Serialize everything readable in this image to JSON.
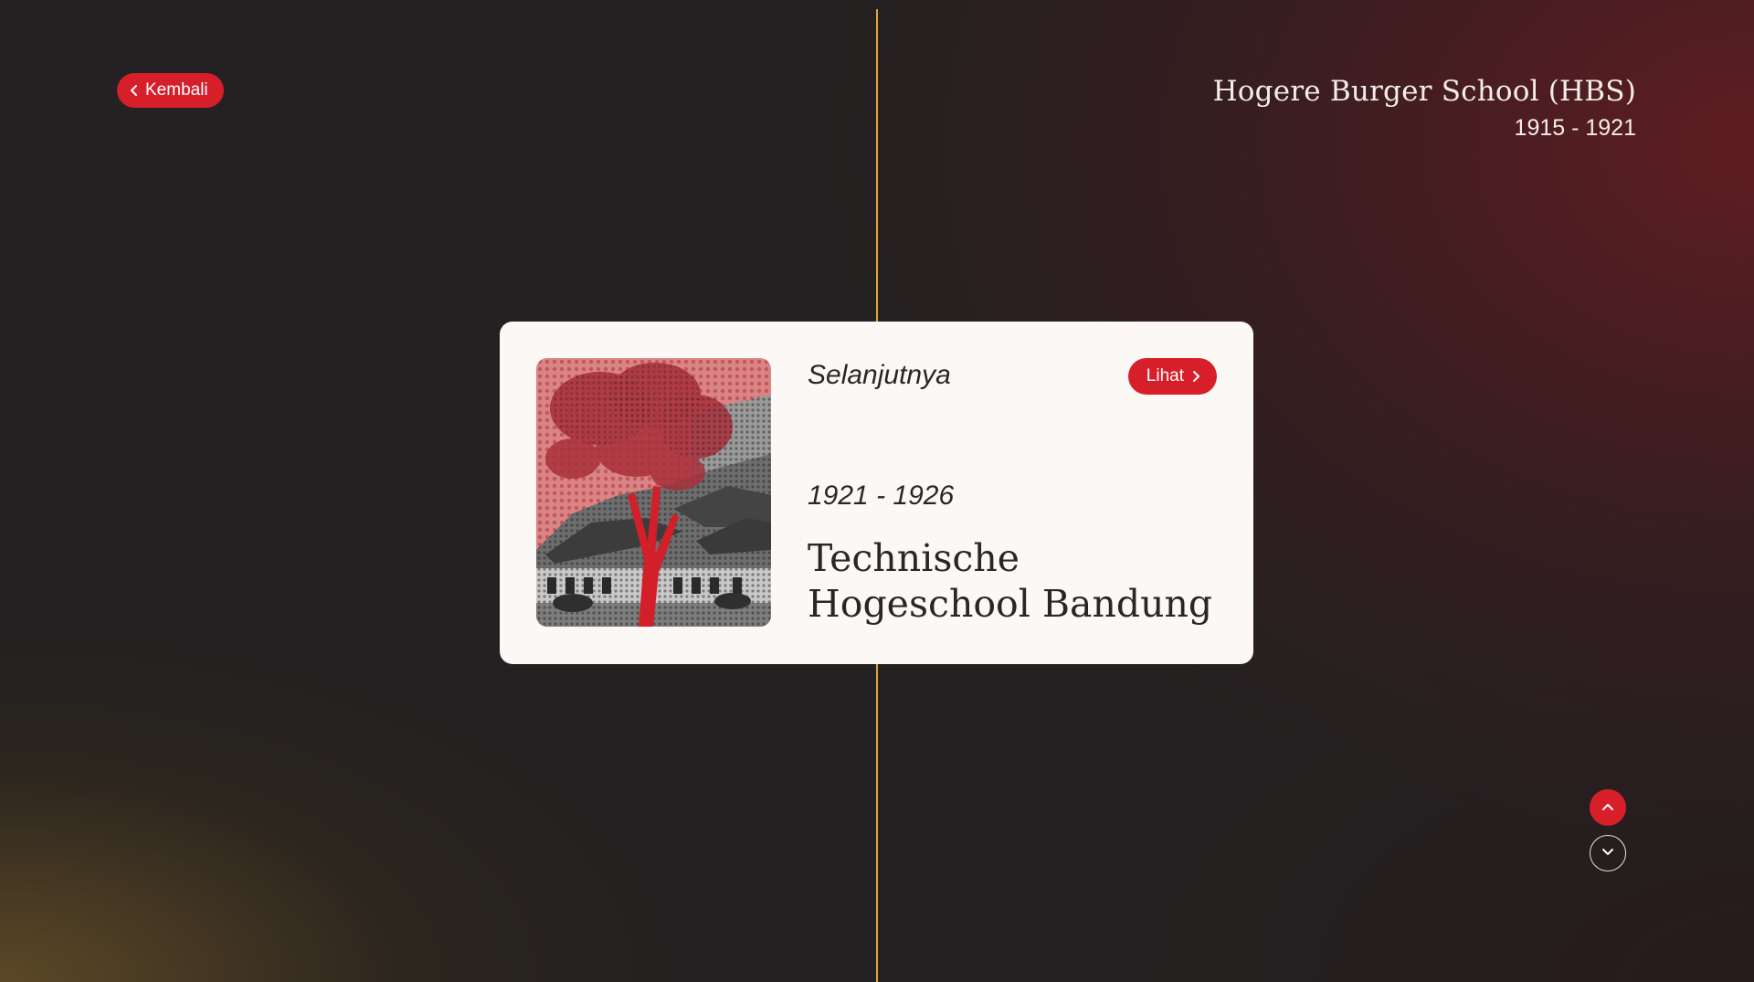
{
  "header": {
    "back_label": "Kembali",
    "current_title": "Hogere Burger School (HBS)",
    "current_years": "1915 - 1921"
  },
  "next_card": {
    "label": "Selanjutnya",
    "view_label": "Lihat",
    "years": "1921 - 1926",
    "title_line1": "Technische",
    "title_line2": "Hogeschool Bandung"
  },
  "nav": {
    "up_icon": "chevron-up-icon",
    "down_icon": "chevron-down-icon"
  },
  "colors": {
    "accent": "#d71f2a",
    "timeline": "#e2a23a",
    "card_bg": "#fcf8f5",
    "text_dark": "#2a2626"
  }
}
